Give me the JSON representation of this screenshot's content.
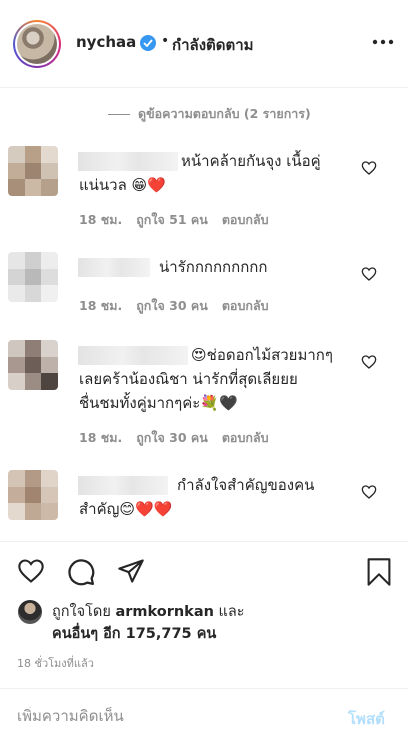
{
  "header": {
    "username": "nychaa",
    "dot": "•",
    "follow_status": "กำลังติดตาม",
    "verified": true,
    "more_icon": "more-horizontal-icon"
  },
  "replies": {
    "view_label": "ดูข้อความตอบกลับ (2 รายการ)"
  },
  "comments": [
    {
      "text": "หน้าคล้ายกันจุง เนื้อคู่ แน่นวล 😁❤️",
      "time": "18 ชม.",
      "likes": "ถูกใจ 51 คน",
      "reply": "ตอบกลับ"
    },
    {
      "text": "น่ารักกกกกกกกก",
      "time": "18 ชม.",
      "likes": "ถูกใจ 30 คน",
      "reply": "ตอบกลับ"
    },
    {
      "text": "😍ช่อดอกไม้สวยมากๆเลยคร้าน้องณิชา น่ารักที่สุดเลียยย ชื่นชมทั้งคู่มากๆค่ะ💐🖤",
      "time": "18 ชม.",
      "likes": "ถูกใจ 30 คน",
      "reply": "ตอบกลับ"
    },
    {
      "text": "กำลังใจสำคัญของคนสำคัญ😊❤️❤️"
    }
  ],
  "actions": {
    "like_icon": "heart-icon",
    "comment_icon": "comment-icon",
    "share_icon": "paper-plane-icon",
    "save_icon": "bookmark-icon"
  },
  "likes_summary": {
    "prefix": "ถูกใจโดย ",
    "user": "armkornkan",
    "suffix": " และ",
    "others": "คนอื่นๆ อีก 175,775 คน"
  },
  "timestamp": "18 ชั่วโมงที่แล้ว",
  "comment_box": {
    "placeholder": "เพิ่มความคิดเห็น",
    "post_label": "โพสต์"
  },
  "colors": {
    "verified": "#3897f0",
    "post_disabled": "#b2dffc",
    "heart_red": "#ed4956",
    "muted": "#8e8e8e"
  }
}
